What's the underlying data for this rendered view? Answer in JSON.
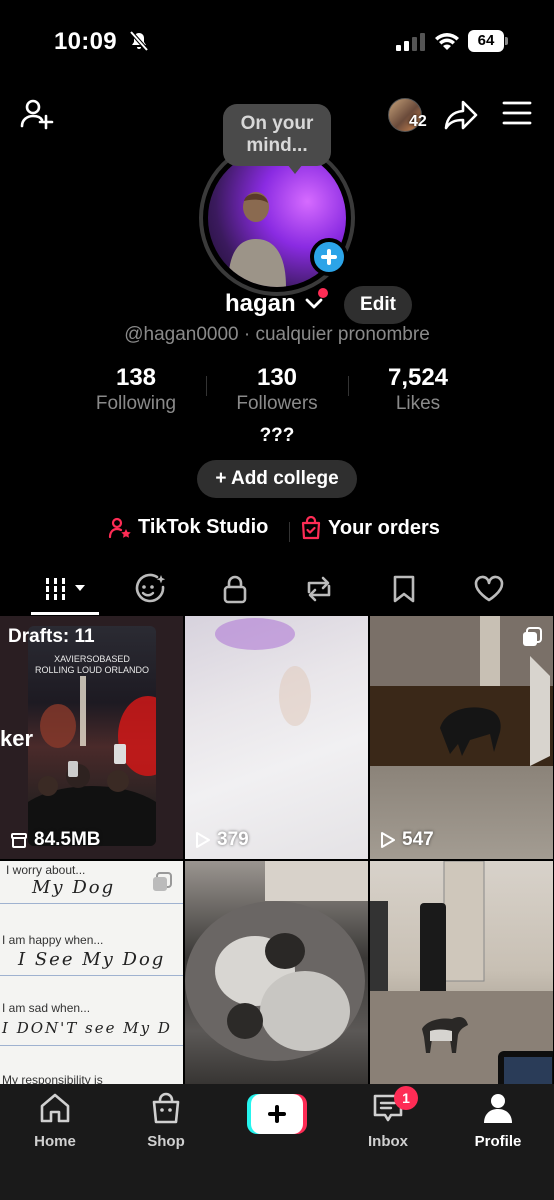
{
  "status_bar": {
    "time": "10:09",
    "battery": "64"
  },
  "header": {
    "friends_count": "42",
    "bubble_text": "On your\nmind...",
    "username": "hagan",
    "edit_label": "Edit",
    "handle_line": "@hagan0000 · cualquier pronombre"
  },
  "stats": [
    {
      "value": "138",
      "label": "Following"
    },
    {
      "value": "130",
      "label": "Followers"
    },
    {
      "value": "7,524",
      "label": "Likes"
    }
  ],
  "bio": "???",
  "add_college_label": "+ Add college",
  "shortcuts": {
    "studio": "TikTok Studio",
    "orders": "Your orders"
  },
  "tabs": [
    "videos-icon",
    "reposts-icon",
    "lock-icon",
    "repost-icon",
    "bookmark-icon",
    "heart-icon"
  ],
  "grid": {
    "drafts_label": "Drafts: 11",
    "draft_caption": "XAVIERSOBASED\nROLLING LOUD ORLANDO",
    "draft_side_text": "ker",
    "draft_size": "84.5MB",
    "views": [
      "379",
      "547"
    ],
    "notes": {
      "line1": "I worry about...",
      "hand1": "My Dog",
      "line2": "I am happy when...",
      "hand2": "I See My Dog",
      "line3": "I am sad when...",
      "hand3": "I DON'T see My D",
      "line4": "My responsibility is"
    }
  },
  "bottom_nav": {
    "home": "Home",
    "shop": "Shop",
    "inbox": "Inbox",
    "inbox_badge": "1",
    "profile": "Profile"
  },
  "colors": {
    "accent_red": "#fe2c55",
    "accent_cyan": "#25f4ee",
    "plus_blue": "#2ca4e8"
  }
}
